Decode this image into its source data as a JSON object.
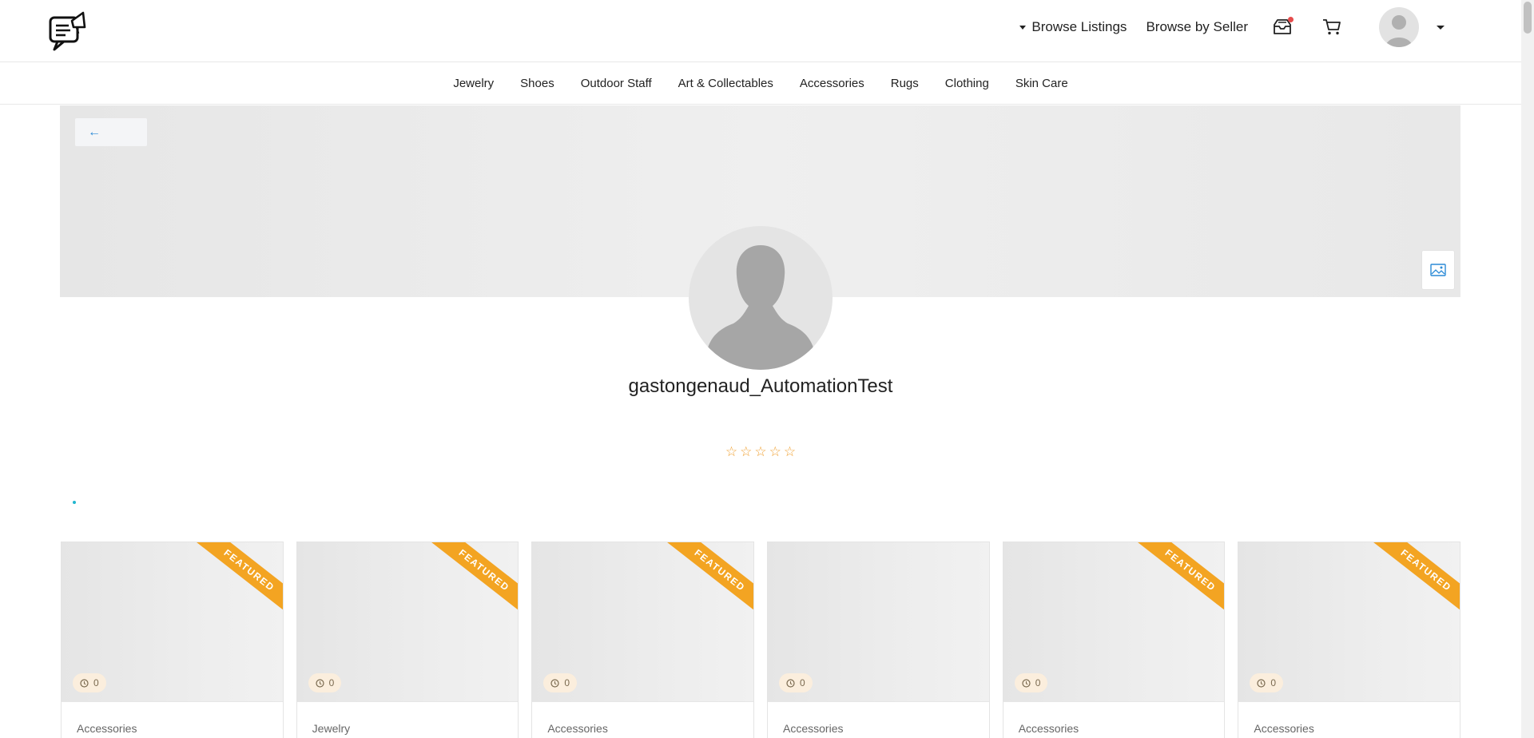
{
  "header": {
    "browse_listings_label": "Browse Listings",
    "browse_by_seller_label": "Browse by Seller"
  },
  "categories": [
    "Jewelry",
    "Shoes",
    "Outdoor Staff",
    "Art & Collectables",
    "Accessories",
    "Rugs",
    "Clothing",
    "Skin Care"
  ],
  "banner": {
    "back_label": "←"
  },
  "profile": {
    "username": "gastongenaud_AutomationTest",
    "rating": 0,
    "stars": [
      "☆",
      "☆",
      "☆",
      "☆",
      "☆"
    ]
  },
  "listings": [
    {
      "category": "Accessories",
      "featured": true,
      "ribbon": "FEATURED",
      "timer": "0"
    },
    {
      "category": "Jewelry",
      "featured": true,
      "ribbon": "FEATURED",
      "timer": "0"
    },
    {
      "category": "Accessories",
      "featured": true,
      "ribbon": "FEATURED",
      "timer": "0"
    },
    {
      "category": "Accessories",
      "featured": false,
      "ribbon": "",
      "timer": "0"
    },
    {
      "category": "Accessories",
      "featured": true,
      "ribbon": "FEATURED",
      "timer": "0"
    },
    {
      "category": "Accessories",
      "featured": true,
      "ribbon": "FEATURED",
      "timer": "0"
    }
  ],
  "colors": {
    "accent": "#f3a422",
    "link": "#2b8ad6",
    "notification": "#e54c4c"
  }
}
